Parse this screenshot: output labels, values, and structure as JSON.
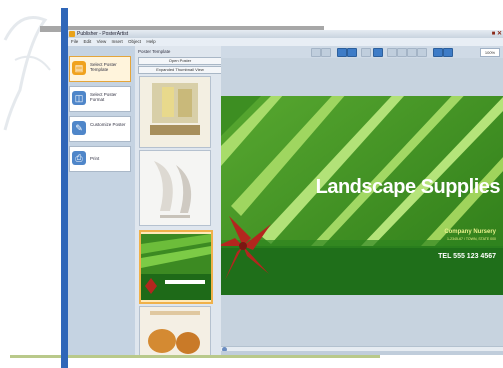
{
  "window": {
    "title": "Publisher - PosterArtist",
    "controls": "■ ✕"
  },
  "menu": {
    "items": [
      "File",
      "Edit",
      "View",
      "Insert",
      "Object",
      "Help"
    ]
  },
  "sidebar": {
    "items": [
      {
        "label": "Select Poster Template",
        "icon": "template-icon",
        "active": true
      },
      {
        "label": "Select Poster Format",
        "icon": "format-icon",
        "active": false
      },
      {
        "label": "Customize Poster",
        "icon": "customize-icon",
        "active": false
      },
      {
        "label": "Print",
        "icon": "print-icon",
        "active": false
      }
    ]
  },
  "template_panel": {
    "title": "Poster Template",
    "button_1": "Open Poster",
    "button_2": "Expanded Thumbnail View"
  },
  "toolbar": {
    "zoom": "100%"
  },
  "poster": {
    "title": "Landscape Supplies",
    "company": "Company Nursery",
    "address": "1-2345-67 / TOWN, STATE 000",
    "tel": "TEL  555 123 4567"
  },
  "colors": {
    "accent_blue": "#2f66b8",
    "poster_green": "#2e7a1e",
    "flower_red": "#b3261e",
    "selection_orange": "#f0b14a"
  }
}
